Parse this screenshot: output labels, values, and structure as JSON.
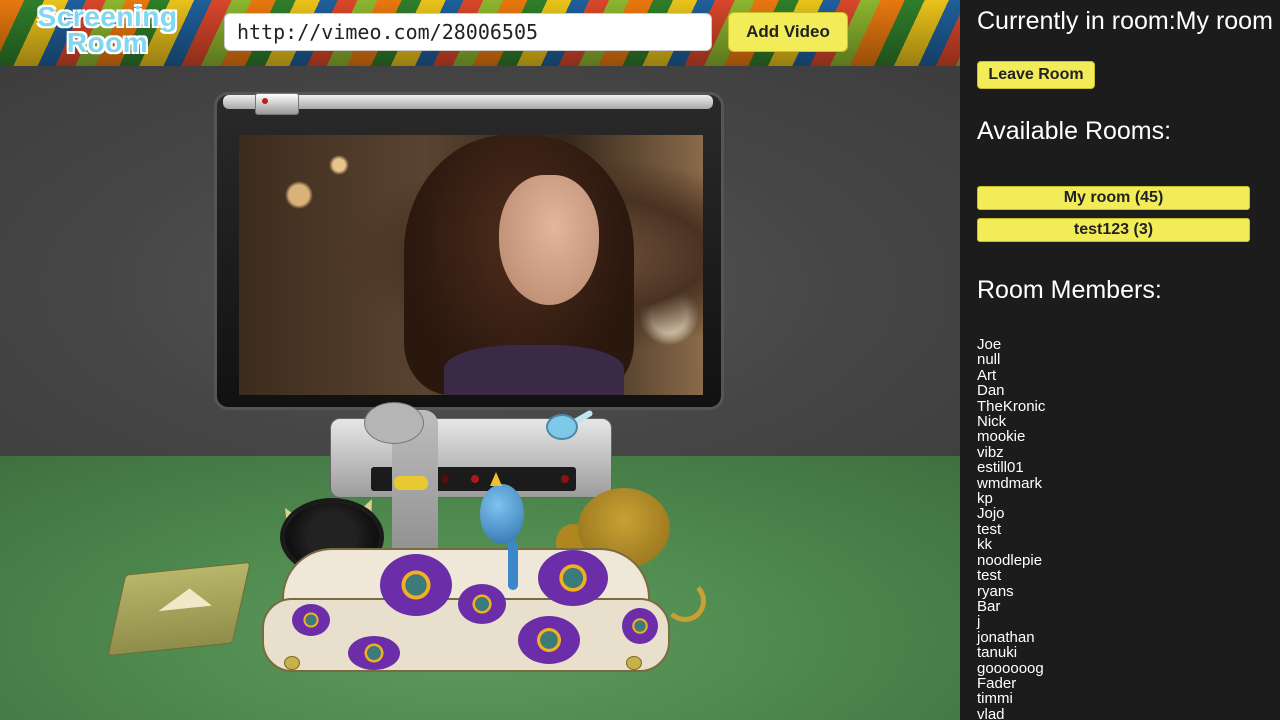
{
  "header": {
    "logo_line1": "Screening",
    "logo_line2": "Room",
    "url_value": "http://vimeo.com/28006505",
    "add_video_label": "Add Video"
  },
  "sidebar": {
    "current_room_prefix": "Currently in room:",
    "current_room_name": "My room",
    "leave_room_label": "Leave Room",
    "available_rooms_heading": "Available Rooms:",
    "rooms": [
      {
        "label": "My room (45)"
      },
      {
        "label": "test123 (3)"
      }
    ],
    "members_heading": "Room Members:",
    "members": [
      "Joe",
      "null",
      "Art",
      "Dan",
      "TheKronic",
      "Nick",
      "mookie",
      "vibz",
      "estill01",
      "wmdmark",
      "kp",
      "Jojo",
      "test",
      "kk",
      "noodlepie",
      "test",
      "ryans",
      "Bar",
      "j",
      "jonathan",
      "tanuki",
      "goooooog",
      "Fader",
      "timmi",
      "vlad"
    ]
  },
  "colors": {
    "button_yellow": "#f3ec59",
    "panel_bg": "#1c1c1c"
  }
}
